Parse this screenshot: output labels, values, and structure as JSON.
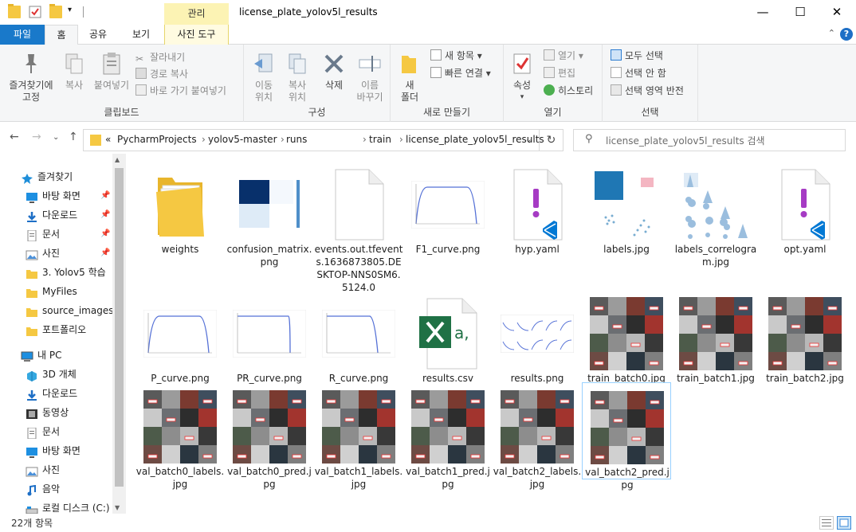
{
  "window": {
    "title": "license_plate_yolov5l_results",
    "context_tab_header": "관리",
    "minimize": "—",
    "maximize": "☐",
    "close": "✕"
  },
  "ribbon_tabs": {
    "file": "파일",
    "home": "홈",
    "share": "공유",
    "view": "보기",
    "picture_tools": "사진 도구"
  },
  "ribbon": {
    "clipboard": {
      "label": "클립보드",
      "pin": "즐겨찾기에\n고정",
      "copy": "복사",
      "paste": "붙여넣기",
      "cut": "잘라내기",
      "copy_path": "경로 복사",
      "paste_shortcut": "바로 가기 붙여넣기"
    },
    "organize": {
      "label": "구성",
      "move_to": "이동\n위치",
      "copy_to": "복사\n위치",
      "delete": "삭제",
      "rename": "이름\n바꾸기"
    },
    "new": {
      "label": "새로 만들기",
      "new_folder": "새\n폴더",
      "new_item": "새 항목",
      "easy_access": "빠른 연결"
    },
    "open": {
      "label": "열기",
      "properties": "속성",
      "open": "열기",
      "edit": "편집",
      "history": "히스토리"
    },
    "select": {
      "label": "선택",
      "select_all": "모두 선택",
      "select_none": "선택 안 함",
      "invert": "선택 영역 반전"
    }
  },
  "address": {
    "overflow": "«",
    "crumbs": [
      "PycharmProjects",
      "yolov5-master",
      "runs",
      "train",
      "license_plate_yolov5l_results"
    ],
    "separator": "›",
    "search_placeholder": "license_plate_yolov5l_results 검색"
  },
  "nav": {
    "quick_access": "즐겨찾기",
    "items": [
      {
        "label": "바탕 화면",
        "icon": "desktop-icon",
        "pinned": true
      },
      {
        "label": "다운로드",
        "icon": "download-icon",
        "pinned": true
      },
      {
        "label": "문서",
        "icon": "document-icon",
        "pinned": true
      },
      {
        "label": "사진",
        "icon": "picture-icon",
        "pinned": true
      },
      {
        "label": "3. Yolov5 학습 ",
        "icon": "folder-icon",
        "pinned": false
      },
      {
        "label": "MyFiles",
        "icon": "folder-icon",
        "pinned": false
      },
      {
        "label": "source_images",
        "icon": "folder-icon",
        "pinned": false
      },
      {
        "label": "포트폴리오",
        "icon": "folder-icon",
        "pinned": false
      }
    ],
    "this_pc": "내 PC",
    "pc_items": [
      {
        "label": "3D 개체",
        "icon": "3d-objects-icon"
      },
      {
        "label": "다운로드",
        "icon": "download-icon"
      },
      {
        "label": "동영상",
        "icon": "video-icon"
      },
      {
        "label": "문서",
        "icon": "document-icon"
      },
      {
        "label": "바탕 화면",
        "icon": "desktop-icon"
      },
      {
        "label": "사진",
        "icon": "picture-icon"
      },
      {
        "label": "음악",
        "icon": "music-icon"
      },
      {
        "label": "로컬 디스크 (C:)",
        "icon": "drive-icon"
      }
    ]
  },
  "files": [
    {
      "name": "weights",
      "kind": "folder"
    },
    {
      "name": "confusion_matrix.png",
      "kind": "confusion"
    },
    {
      "name": "events.out.tfevents.1636873805.DESKTOP-NNS0SM6.5124.0",
      "kind": "blank"
    },
    {
      "name": "F1_curve.png",
      "kind": "curve"
    },
    {
      "name": "hyp.yaml",
      "kind": "yaml"
    },
    {
      "name": "labels.jpg",
      "kind": "labels"
    },
    {
      "name": "labels_correlogram.jpg",
      "kind": "correlogram"
    },
    {
      "name": "opt.yaml",
      "kind": "yaml"
    },
    {
      "name": "P_curve.png",
      "kind": "curve"
    },
    {
      "name": "PR_curve.png",
      "kind": "prcurve"
    },
    {
      "name": "R_curve.png",
      "kind": "rcurve"
    },
    {
      "name": "results.csv",
      "kind": "csv"
    },
    {
      "name": "results.png",
      "kind": "results"
    },
    {
      "name": "train_batch0.jpg",
      "kind": "photos"
    },
    {
      "name": "train_batch1.jpg",
      "kind": "photos"
    },
    {
      "name": "train_batch2.jpg",
      "kind": "photos"
    },
    {
      "name": "val_batch0_labels.jpg",
      "kind": "photos"
    },
    {
      "name": "val_batch0_pred.jpg",
      "kind": "photos"
    },
    {
      "name": "val_batch1_labels.jpg",
      "kind": "photos"
    },
    {
      "name": "val_batch1_pred.jpg",
      "kind": "photos"
    },
    {
      "name": "val_batch2_labels.jpg",
      "kind": "photos"
    },
    {
      "name": "val_batch2_pred.jpg",
      "kind": "photos",
      "selected": true
    }
  ],
  "status": {
    "item_count": "22개 항목"
  },
  "colors": {
    "accent": "#1979ca",
    "context_tab": "#fcf3b4",
    "folder": "#f5c842",
    "selection_border": "#99d1ff",
    "excel_green": "#1f7145",
    "vscode_blue": "#0078d4",
    "yaml_purple": "#a63bc4"
  }
}
